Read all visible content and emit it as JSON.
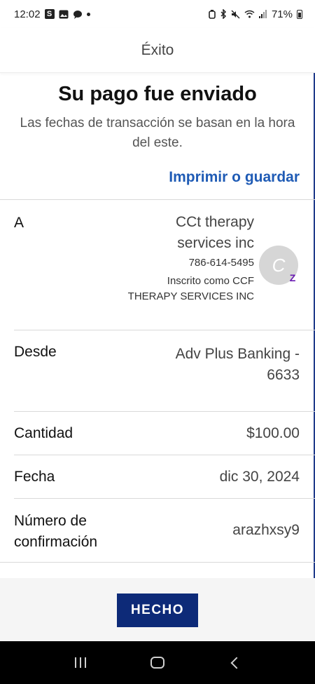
{
  "status_bar": {
    "time": "12:02",
    "left_icons": [
      "s-app-icon",
      "gallery-icon",
      "chat-bubble-icon",
      "notification-dot-icon"
    ],
    "right_icons": [
      "alarm-icon",
      "bluetooth-icon",
      "mute-icon",
      "wifi-icon",
      "signal-icon",
      "battery-icon"
    ],
    "battery": "71%"
  },
  "header": {
    "title": "Éxito"
  },
  "confirmation": {
    "headline": "Su pago fue enviado",
    "subtext": "Las fechas de transacción se basan en la hora del este.",
    "print_link": "Imprimir o guardar"
  },
  "details": {
    "to": {
      "label": "A",
      "name": "CCt therapy services inc",
      "phone": "786-614-5495",
      "enrolled": "Inscrito como CCF THERAPY SERVICES INC",
      "avatar_initial": "C",
      "badge": "Z"
    },
    "from": {
      "label": "Desde",
      "value": "Adv Plus Banking - 6633"
    },
    "amount": {
      "label": "Cantidad",
      "value": "$100.00"
    },
    "date": {
      "label": "Fecha",
      "value": "dic 30, 2024"
    },
    "confirmation_number": {
      "label": "Número de confirmación",
      "value": "arazhxsy9"
    }
  },
  "footer": {
    "done_label": "HECHO"
  },
  "nav_bar": {
    "buttons": [
      "recents-icon",
      "home-icon",
      "back-icon"
    ]
  },
  "colors": {
    "accent_button": "#0d2a78",
    "link": "#1f5bb5",
    "zelle": "#6a1bb2"
  }
}
